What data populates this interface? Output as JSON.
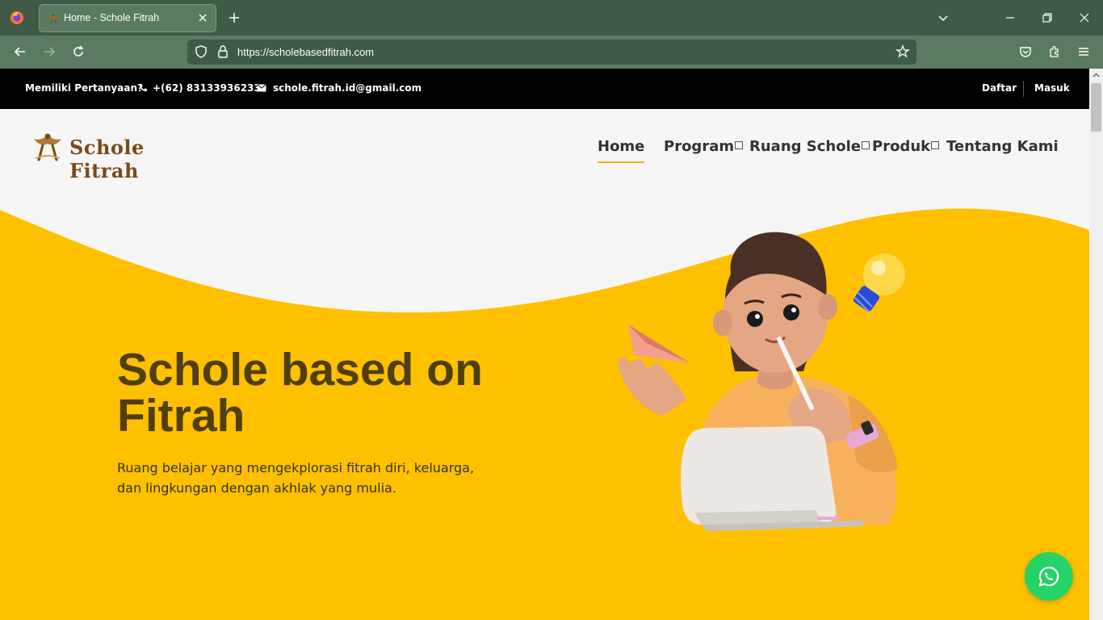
{
  "browser": {
    "tab_title": "Home - Schole Fitrah",
    "url": "https://scholebasedfitrah.com"
  },
  "topbar": {
    "question": "Memiliki Pertanyaan?",
    "phone": "+(62) 83133936233",
    "email": "schole.fitrah.id@gmail.com",
    "register": "Daftar",
    "login": "Masuk"
  },
  "header": {
    "logo_text": "Schole Fitrah",
    "menu": [
      {
        "label": "Home",
        "active": true
      },
      {
        "label": "Program",
        "dropdown": true
      },
      {
        "label": "Ruang Schole",
        "dropdown": true
      },
      {
        "label": "Produk",
        "dropdown": true
      },
      {
        "label": "Tentang Kami"
      }
    ]
  },
  "hero": {
    "title": "Schole based on Fitrah",
    "subtitle": "Ruang belajar yang mengekplorasi fitrah diri, keluarga, dan lingkungan dengan akhlak yang mulia."
  },
  "colors": {
    "accent": "#ffc000",
    "topbar": "#000000",
    "title": "#4f3f0e",
    "whatsapp": "#25d366",
    "browser_chrome": "#3f5b47"
  },
  "icons": {
    "phone": "phone-icon",
    "email": "envelope-icon",
    "whatsapp": "whatsapp-icon"
  }
}
